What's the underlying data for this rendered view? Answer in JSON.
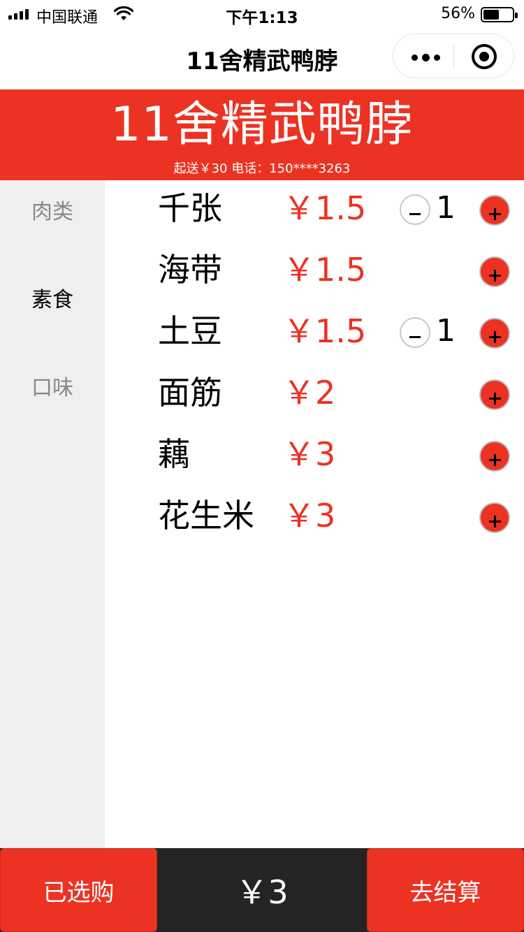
{
  "status_bar": {
    "carrier": "中国联通",
    "time": "下午1:13",
    "battery_percent": "56%",
    "battery_level": 0.56
  },
  "nav": {
    "title": "11舍精武鸭脖",
    "more_icon": "more-dots-icon",
    "close_icon": "target-circle-icon"
  },
  "banner": {
    "shop_name": "11舍精武鸭脖",
    "info": "起送￥30 电话：150****3263"
  },
  "categories": [
    {
      "label": "肉类",
      "active": false
    },
    {
      "label": "素食",
      "active": true
    },
    {
      "label": "口味",
      "active": false
    }
  ],
  "items": [
    {
      "name": "千张",
      "price": "￥1.5",
      "qty": "1"
    },
    {
      "name": "海带",
      "price": "￥1.5",
      "qty": ""
    },
    {
      "name": "土豆",
      "price": "￥1.5",
      "qty": "1"
    },
    {
      "name": "面筋",
      "price": "￥2",
      "qty": ""
    },
    {
      "name": "藕",
      "price": "￥3",
      "qty": ""
    },
    {
      "name": "花生米",
      "price": "￥3",
      "qty": ""
    }
  ],
  "bottom": {
    "selected_label": "已选购",
    "total": "￥3",
    "checkout_label": "去结算"
  },
  "colors": {
    "accent": "#ec3223",
    "sidebar_bg": "#efefef",
    "bottom_bar_bg": "#242424",
    "inactive_text": "#888888"
  }
}
